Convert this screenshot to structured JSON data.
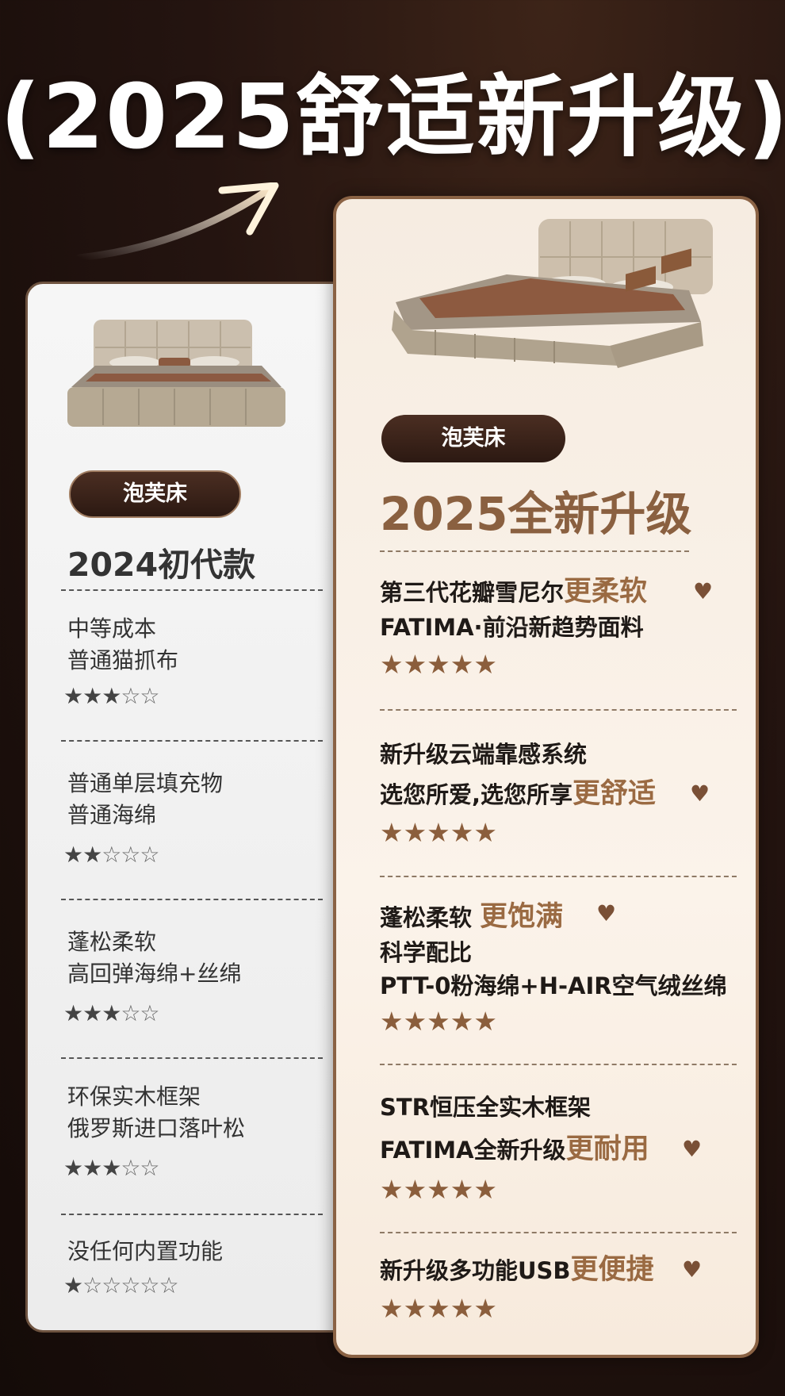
{
  "title": "(2025舒适新升级)",
  "left": {
    "tag": "泡芙床",
    "heading": "2024初代款",
    "items": [
      {
        "line1": "中等成本",
        "line2": "普通猫抓布",
        "rating": 3
      },
      {
        "line1": "普通单层填充物",
        "line2": "普通海绵",
        "rating": 2
      },
      {
        "line1": "蓬松柔软",
        "line2": "高回弹海绵+丝绵",
        "rating": 3
      },
      {
        "line1": "环保实木框架",
        "line2": "俄罗斯进口落叶松",
        "rating": 3
      },
      {
        "line1": "没任何内置功能",
        "line2": "",
        "rating": 1
      }
    ]
  },
  "right": {
    "tag": "泡芙床",
    "heading": "2025全新升级",
    "items": [
      {
        "line1": "第三代花瓣雪尼尔",
        "highlight": "更柔软",
        "line2": "FATIMA·前沿新趋势面料",
        "rating": 5
      },
      {
        "line1": "新升级云端靠感系统",
        "line2": "选您所爱,选您所享",
        "highlight": "更舒适",
        "rating": 5
      },
      {
        "line1": "蓬松柔软 ",
        "highlight": "更饱满",
        "line2": "科学配比",
        "line3": "PTT-0粉海绵+H-AIR空气绒丝绵",
        "rating": 5
      },
      {
        "line1": "STR恒压全实木框架",
        "line2": "FATIMA全新升级",
        "highlight": "更耐用",
        "rating": 5
      },
      {
        "line1": "新升级多功能USB",
        "highlight": "更便捷",
        "rating": 5
      }
    ]
  },
  "colors": {
    "accent": "#8a6040",
    "dark": "#2c1912",
    "star_right": "#8b5e3c"
  }
}
